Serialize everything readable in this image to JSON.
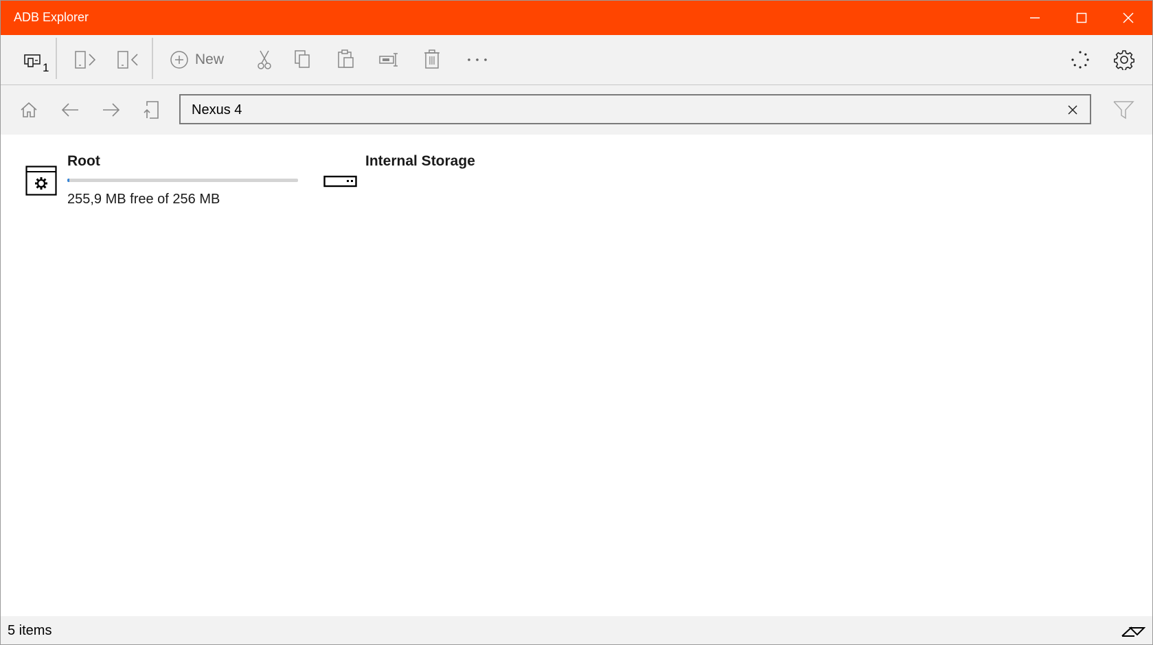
{
  "window": {
    "title": "ADB Explorer",
    "accent_color": "#ff4500"
  },
  "commandbar": {
    "device_count": "1",
    "new_label": "New",
    "icons": [
      "devices-icon",
      "push-to-device-icon",
      "pull-from-device-icon",
      "new-icon",
      "cut-icon",
      "copy-icon",
      "paste-icon",
      "rename-icon",
      "delete-icon",
      "more-icon",
      "progress-icon",
      "settings-icon"
    ]
  },
  "navigation": {
    "address_value": "Nexus 4",
    "icons": [
      "home-icon",
      "back-icon",
      "forward-icon",
      "up-icon",
      "clear-icon",
      "filter-icon"
    ]
  },
  "drives": [
    {
      "name": "Root",
      "free_text": "255,9 MB free of 256 MB",
      "usage_fraction": 0.0004,
      "icon": "root-drive-icon"
    },
    {
      "name": "Internal Storage",
      "icon": "internal-storage-icon"
    }
  ],
  "status": {
    "item_count": "5 items"
  }
}
